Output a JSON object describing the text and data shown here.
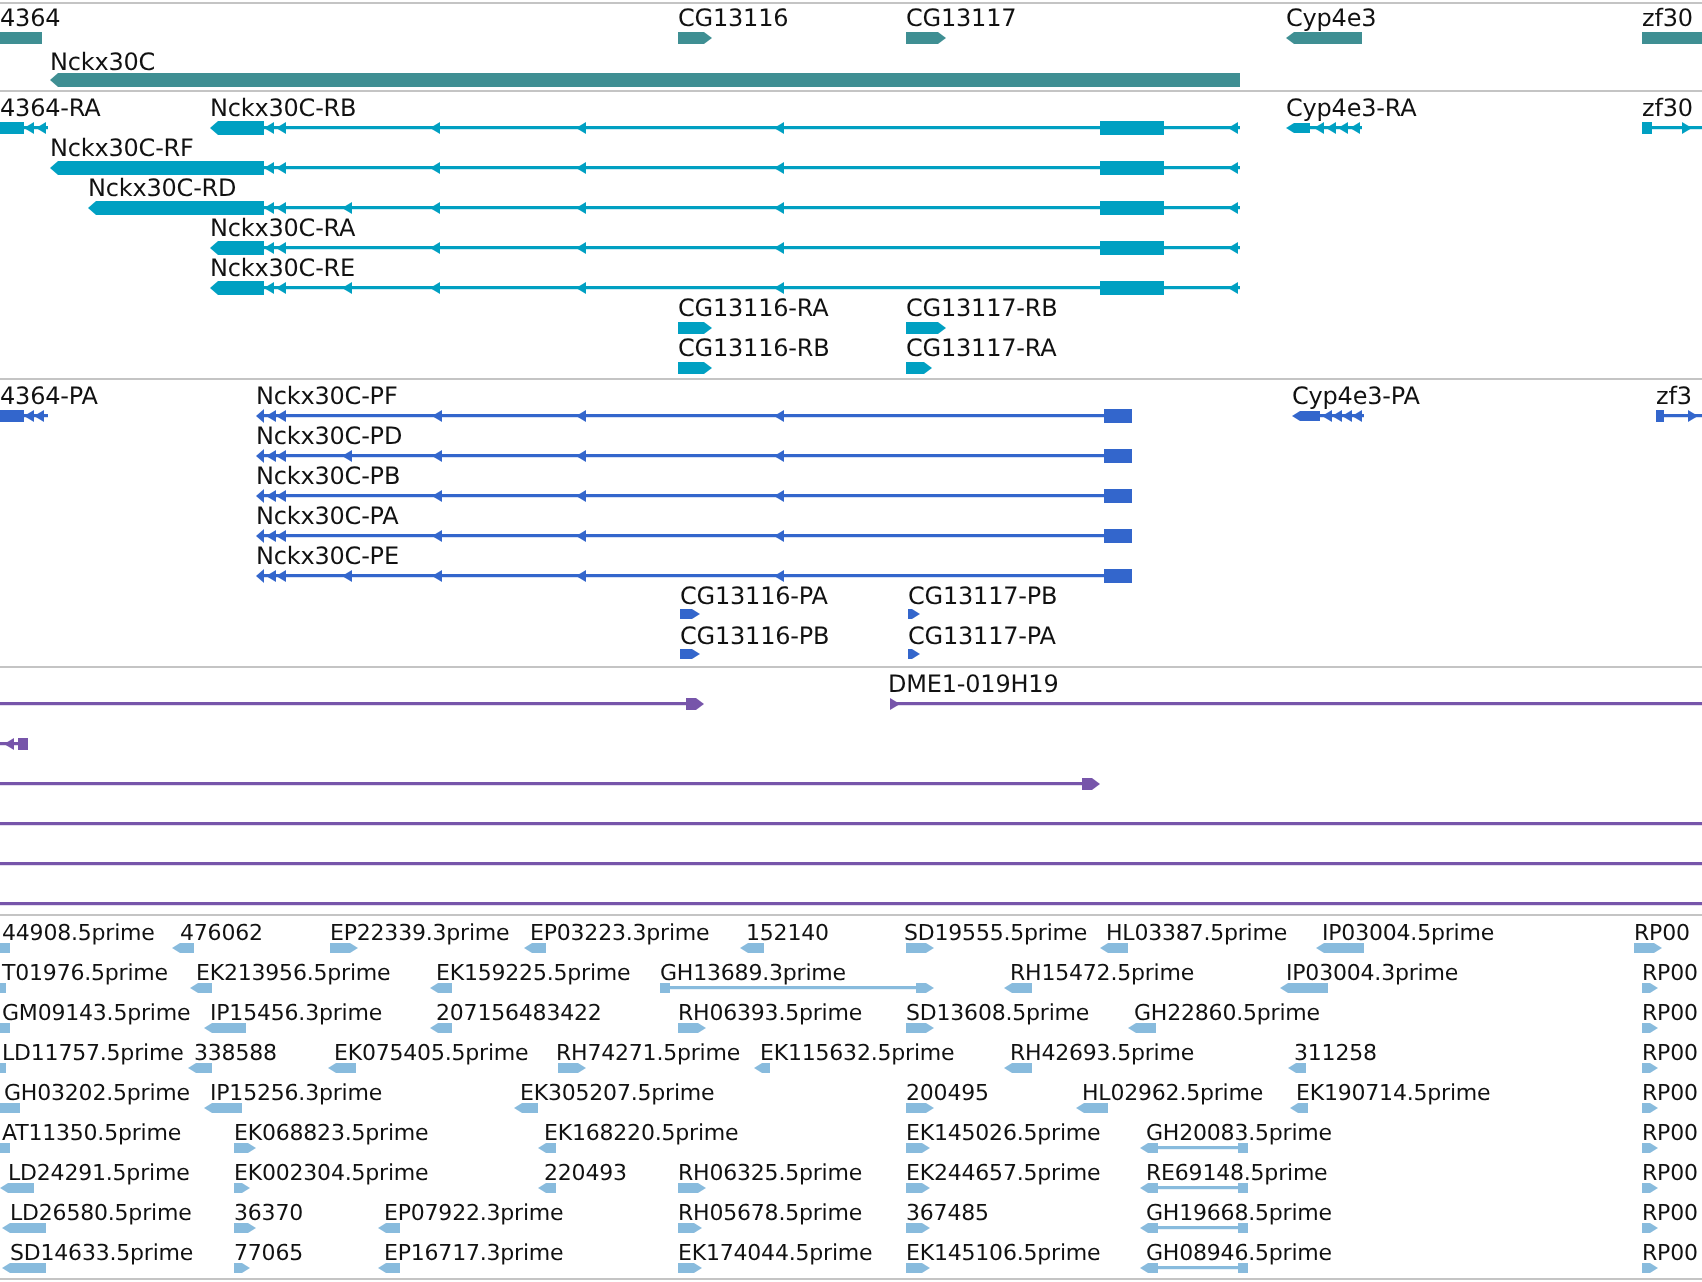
{
  "tracks": [
    {
      "kind": "gene",
      "features": [
        {
          "label": "4364",
          "reverse": true
        },
        {
          "label": "CG13116",
          "reverse": false
        },
        {
          "label": "CG13117",
          "reverse": false
        },
        {
          "label": "Cyp4e3",
          "reverse": true
        },
        {
          "label": "zf30",
          "reverse": false
        },
        {
          "label": "Nckx30C",
          "reverse": true
        }
      ]
    },
    {
      "kind": "transcript",
      "features": [
        {
          "label": "4364-RA",
          "reverse": true
        },
        {
          "label": "Nckx30C-RB",
          "reverse": true
        },
        {
          "label": "Nckx30C-RF",
          "reverse": true
        },
        {
          "label": "Nckx30C-RD",
          "reverse": true
        },
        {
          "label": "Nckx30C-RA",
          "reverse": true
        },
        {
          "label": "Nckx30C-RE",
          "reverse": true
        },
        {
          "label": "Cyp4e3-RA",
          "reverse": true
        },
        {
          "label": "zf30",
          "reverse": false
        },
        {
          "label": "CG13116-RA",
          "reverse": false
        },
        {
          "label": "CG13116-RB",
          "reverse": false
        },
        {
          "label": "CG13117-RB",
          "reverse": false
        },
        {
          "label": "CG13117-RA",
          "reverse": false
        }
      ]
    },
    {
      "kind": "protein",
      "features": [
        {
          "label": "4364-PA",
          "reverse": true
        },
        {
          "label": "Nckx30C-PF",
          "reverse": true
        },
        {
          "label": "Nckx30C-PD",
          "reverse": true
        },
        {
          "label": "Nckx30C-PB",
          "reverse": true
        },
        {
          "label": "Nckx30C-PA",
          "reverse": true
        },
        {
          "label": "Nckx30C-PE",
          "reverse": true
        },
        {
          "label": "Cyp4e3-PA",
          "reverse": true
        },
        {
          "label": "zf3",
          "reverse": false
        },
        {
          "label": "CG13116-PA",
          "reverse": false
        },
        {
          "label": "CG13116-PB",
          "reverse": false
        },
        {
          "label": "CG13117-PB",
          "reverse": false
        },
        {
          "label": "CG13117-PA",
          "reverse": false
        }
      ]
    },
    {
      "kind": "clone",
      "features": [
        {
          "kind": "arrow",
          "reverse": false
        },
        {
          "kind": "arrow",
          "label": "DME1-019H19",
          "reverse": false
        },
        {
          "kind": "arrow",
          "reverse": true
        },
        {
          "kind": "arrow",
          "reverse": false
        },
        {
          "kind": "span"
        },
        {
          "kind": "span"
        },
        {
          "kind": "span"
        }
      ]
    },
    {
      "kind": "est",
      "features": [
        {
          "label": "44908.5prime",
          "reverse": true
        },
        {
          "label": "476062",
          "reverse": true
        },
        {
          "label": "EP22339.3prime",
          "reverse": false
        },
        {
          "label": "EP03223.3prime",
          "reverse": true
        },
        {
          "label": "152140",
          "reverse": true
        },
        {
          "label": "SD19555.5prime",
          "reverse": false
        },
        {
          "label": "HL03387.5prime",
          "reverse": true
        },
        {
          "label": "IP03004.5prime",
          "reverse": true
        },
        {
          "label": "RP00",
          "reverse": false
        },
        {
          "label": "T01976.5prime",
          "reverse": true
        },
        {
          "label": "EK213956.5prime",
          "reverse": true
        },
        {
          "label": "EK159225.5prime",
          "reverse": true
        },
        {
          "label": "GH13689.3prime",
          "reverse": false
        },
        {
          "label": "RH15472.5prime",
          "reverse": true
        },
        {
          "label": "IP03004.3prime",
          "reverse": true
        },
        {
          "label": "RP00",
          "reverse": false
        },
        {
          "label": "GM09143.5prime",
          "reverse": true
        },
        {
          "label": "IP15456.3prime",
          "reverse": true
        },
        {
          "label": "207156483422",
          "reverse": true
        },
        {
          "label": "RH06393.5prime",
          "reverse": false
        },
        {
          "label": "SD13608.5prime",
          "reverse": false
        },
        {
          "label": "GH22860.5prime",
          "reverse": true
        },
        {
          "label": "RP00",
          "reverse": false
        },
        {
          "label": "LD11757.5prime",
          "reverse": true
        },
        {
          "label": "338588",
          "reverse": true
        },
        {
          "label": "EK075405.5prime",
          "reverse": true
        },
        {
          "label": "RH74271.5prime",
          "reverse": false
        },
        {
          "label": "EK115632.5prime",
          "reverse": true
        },
        {
          "label": "RH42693.5prime",
          "reverse": true
        },
        {
          "label": "311258",
          "reverse": true
        },
        {
          "label": "RP00",
          "reverse": false
        },
        {
          "label": "GH03202.5prime",
          "reverse": true
        },
        {
          "label": "IP15256.3prime",
          "reverse": true
        },
        {
          "label": "EK305207.5prime",
          "reverse": true
        },
        {
          "label": "200495",
          "reverse": false
        },
        {
          "label": "HL02962.5prime",
          "reverse": true
        },
        {
          "label": "EK190714.5prime",
          "reverse": true
        },
        {
          "label": "RP00",
          "reverse": false
        },
        {
          "label": "AT11350.5prime",
          "reverse": true
        },
        {
          "label": "EK068823.5prime",
          "reverse": false
        },
        {
          "label": "EK168220.5prime",
          "reverse": true
        },
        {
          "label": "EK145026.5prime",
          "reverse": false
        },
        {
          "label": "GH20083.5prime",
          "reverse": true
        },
        {
          "label": "RP00",
          "reverse": false
        },
        {
          "label": "LD24291.5prime",
          "reverse": true
        },
        {
          "label": "EK002304.5prime",
          "reverse": false
        },
        {
          "label": "220493",
          "reverse": true
        },
        {
          "label": "RH06325.5prime",
          "reverse": false
        },
        {
          "label": "EK244657.5prime",
          "reverse": false
        },
        {
          "label": "RE69148.5prime",
          "reverse": true
        },
        {
          "label": "RP00",
          "reverse": false
        },
        {
          "label": "LD26580.5prime",
          "reverse": true
        },
        {
          "label": "36370",
          "reverse": false
        },
        {
          "label": "EP07922.3prime",
          "reverse": true
        },
        {
          "label": "RH05678.5prime",
          "reverse": false
        },
        {
          "label": "367485",
          "reverse": false
        },
        {
          "label": "GH19668.5prime",
          "reverse": true
        },
        {
          "label": "RP00",
          "reverse": false
        },
        {
          "label": "SD14633.5prime",
          "reverse": true
        },
        {
          "label": "77065",
          "reverse": false
        },
        {
          "label": "EP16717.3prime",
          "reverse": true
        },
        {
          "label": "EK174044.5prime",
          "reverse": false
        },
        {
          "label": "EK145106.5prime",
          "reverse": false
        },
        {
          "label": "GH08946.5prime",
          "reverse": true
        },
        {
          "label": "RP00",
          "reverse": false
        }
      ]
    }
  ]
}
